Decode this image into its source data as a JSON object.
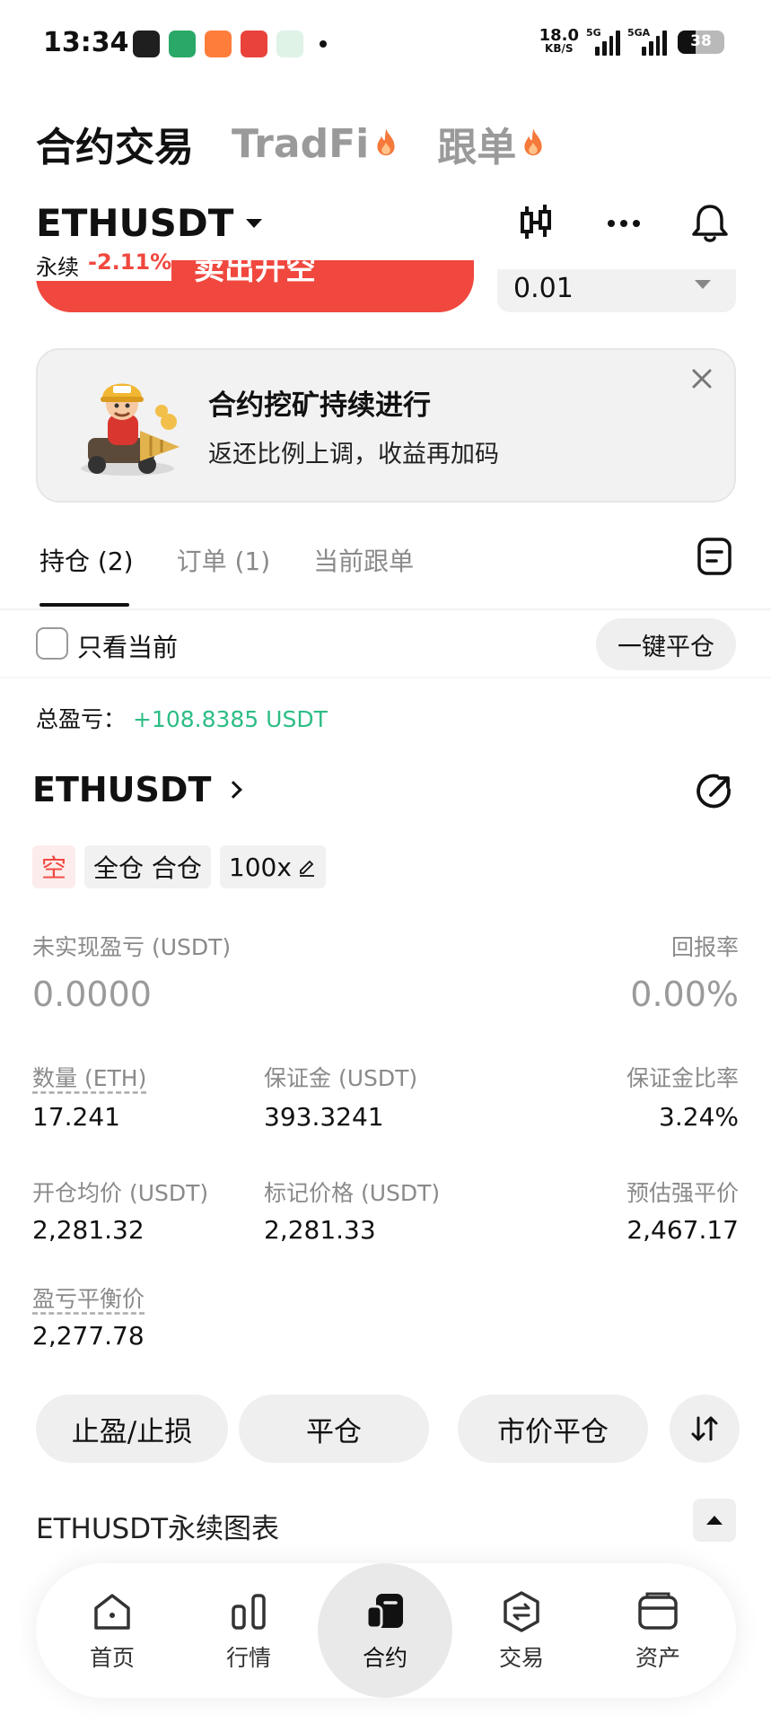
{
  "status_bar": {
    "time": "13:34",
    "net_speed": "18.0",
    "net_unit": "KB/S",
    "sig1_label": "5G",
    "sig2_label": "5GA",
    "battery": "38",
    "battery_level": 0.38
  },
  "top_tabs": [
    {
      "label": "合约交易",
      "active": true,
      "fire": false
    },
    {
      "label": "TradFi",
      "active": false,
      "fire": true
    },
    {
      "label": "跟单",
      "active": false,
      "fire": true
    }
  ],
  "header": {
    "symbol": "ETHUSDT",
    "type": "永续",
    "change": "-2.11%"
  },
  "order_row": {
    "button_label": "卖出开空",
    "quantity": "0.01"
  },
  "banner": {
    "title": "合约挖矿持续进行",
    "subtitle": "返还比例上调，收益再加码"
  },
  "position_tabs": [
    "持仓 (2)",
    "订单 (1)",
    "当前跟单"
  ],
  "filter": {
    "only_current": "只看当前",
    "close_all": "一键平仓"
  },
  "total_pnl": {
    "label": "总盈亏：",
    "value": "+108.8385 USDT"
  },
  "position": {
    "symbol": "ETHUSDT",
    "side": "空",
    "margin_mode": "全仓 合仓",
    "leverage": "100x",
    "unrealized_label": "未实现盈亏 (USDT)",
    "unrealized_value": "0.0000",
    "roe_label": "回报率",
    "roe_value": "0.00%",
    "size_label": "数量 (ETH)",
    "size_value": "17.241",
    "margin_label": "保证金 (USDT)",
    "margin_value": "393.3241",
    "margin_ratio_label": "保证金比率",
    "margin_ratio_value": "3.24%",
    "entry_label": "开仓均价 (USDT)",
    "entry_value": "2,281.32",
    "mark_label": "标记价格 (USDT)",
    "mark_value": "2,281.33",
    "liq_label": "预估强平价",
    "liq_value": "2,467.17",
    "breakeven_label": "盈亏平衡价",
    "breakeven_value": "2,277.78"
  },
  "actions": {
    "tpsl": "止盈/止损",
    "close": "平仓",
    "market_close": "市价平仓"
  },
  "chart_section": {
    "title": "ETHUSDT永续图表"
  },
  "bottom_nav": [
    {
      "label": "首页",
      "icon": "home-icon"
    },
    {
      "label": "行情",
      "icon": "market-icon"
    },
    {
      "label": "合约",
      "icon": "futures-icon",
      "active": true
    },
    {
      "label": "交易",
      "icon": "trade-icon"
    },
    {
      "label": "资产",
      "icon": "wallet-icon"
    }
  ],
  "colors": {
    "red": "#f0483e",
    "green": "#2dbd85",
    "fire": "#f5793b"
  }
}
